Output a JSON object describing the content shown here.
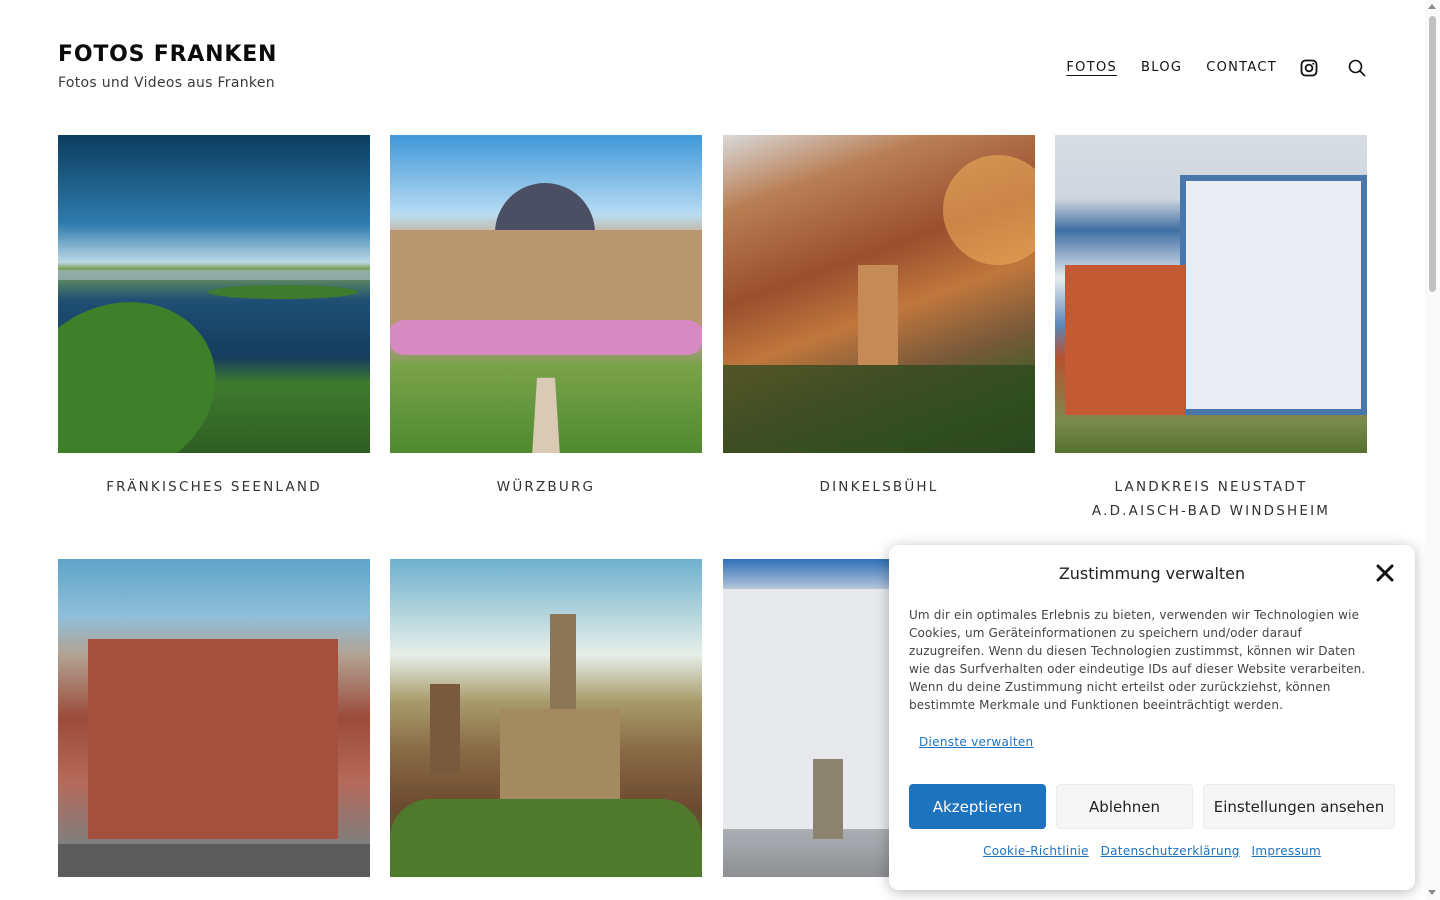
{
  "site": {
    "title": "FOTOS FRANKEN",
    "tagline": "Fotos und Videos aus Franken"
  },
  "nav": {
    "items": [
      {
        "label": "FOTOS",
        "active": true
      },
      {
        "label": "BLOG",
        "active": false
      },
      {
        "label": "CONTACT",
        "active": false
      }
    ],
    "icons": [
      "instagram-icon",
      "search-icon"
    ]
  },
  "gallery": {
    "tiles": [
      {
        "caption_line1": "FRÄNKISCHES SEENLAND",
        "caption_line2": ""
      },
      {
        "caption_line1": "WÜRZBURG",
        "caption_line2": ""
      },
      {
        "caption_line1": "DINKELSBÜHL",
        "caption_line2": ""
      },
      {
        "caption_line1": "LANDKREIS NEUSTADT",
        "caption_line2": "A.D.AISCH-BAD WINDSHEIM"
      },
      {
        "caption_line1": "",
        "caption_line2": ""
      },
      {
        "caption_line1": "",
        "caption_line2": ""
      },
      {
        "caption_line1": "",
        "caption_line2": ""
      }
    ]
  },
  "consent": {
    "title": "Zustimmung verwalten",
    "body": "Um dir ein optimales Erlebnis zu bieten, verwenden wir Technologien wie Cookies, um Geräteinformationen zu speichern und/oder darauf zuzugreifen. Wenn du diesen Technologien zustimmst, können wir Daten wie das Surfverhalten oder eindeutige IDs auf dieser Website verarbeiten. Wenn du deine Zustimmung nicht erteilst oder zurückziehst, können bestimmte Merkmale und Funktionen beeinträchtigt werden.",
    "manage_link": "Dienste verwalten",
    "accept_label": "Akzeptieren",
    "deny_label": "Ablehnen",
    "prefs_label": "Einstellungen ansehen",
    "links": [
      "Cookie-Richtlinie",
      "Datenschutzerklärung",
      "Impressum"
    ],
    "accent_color": "#1e73be"
  }
}
